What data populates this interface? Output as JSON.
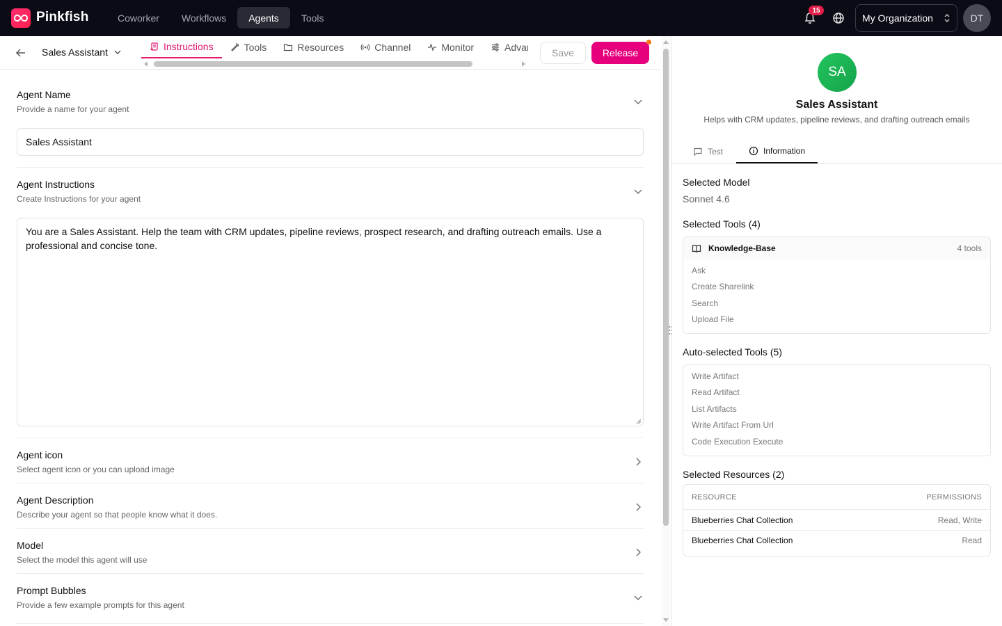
{
  "topbar": {
    "brand": "Pinkfish",
    "nav": [
      "Coworker",
      "Workflows",
      "Agents",
      "Tools"
    ],
    "active_nav": "Agents",
    "notification_count": "15",
    "organization": "My Organization",
    "user_initials": "DT"
  },
  "subheader": {
    "agent_name": "Sales Assistant",
    "tabs": [
      "Instructions",
      "Tools",
      "Resources",
      "Channel",
      "Monitor",
      "Advanced"
    ],
    "active_tab": "Instructions",
    "save_label": "Save",
    "release_label": "Release"
  },
  "form": {
    "agent_name": {
      "title": "Agent Name",
      "desc": "Provide a name for your agent",
      "value": "Sales Assistant"
    },
    "instructions": {
      "title": "Agent Instructions",
      "desc": "Create Instructions for your agent",
      "value": "You are a Sales Assistant. Help the team with CRM updates, pipeline reviews, prospect research, and drafting outreach emails. Use a professional and concise tone."
    },
    "icon": {
      "title": "Agent icon",
      "desc": "Select agent icon or you can upload image"
    },
    "description": {
      "title": "Agent Description",
      "desc": "Describe your agent so that people know what it does."
    },
    "model": {
      "title": "Model",
      "desc": "Select the model this agent will use"
    },
    "prompt_bubbles": {
      "title": "Prompt Bubbles",
      "desc": "Provide a few example prompts for this agent"
    }
  },
  "panel": {
    "avatar_initials": "SA",
    "title": "Sales Assistant",
    "subtitle": "Helps with CRM updates, pipeline reviews, and drafting outreach emails",
    "tabs": {
      "test": "Test",
      "information": "Information"
    },
    "model_label": "Selected Model",
    "model_value": "Sonnet 4.6",
    "tools_label": "Selected Tools (4)",
    "tool_group": {
      "name": "Knowledge-Base",
      "count": "4 tools",
      "items": [
        "Ask",
        "Create Sharelink",
        "Search",
        "Upload File"
      ]
    },
    "auto_tools_label": "Auto-selected Tools (5)",
    "auto_tools": [
      "Write Artifact",
      "Read Artifact",
      "List Artifacts",
      "Write Artifact From Url",
      "Code Execution Execute"
    ],
    "resources_label": "Selected Resources (2)",
    "resources_header": {
      "resource": "RESOURCE",
      "permissions": "PERMISSIONS"
    },
    "resources": [
      {
        "name": "Blueberries Chat Collection",
        "permissions": "Read, Write"
      },
      {
        "name": "Blueberries Chat Collection",
        "permissions": "Read"
      }
    ]
  },
  "colors": {
    "accent": "#e6007e",
    "topbar_bg": "#0b0b16",
    "agent_avatar": "#22c55e"
  }
}
